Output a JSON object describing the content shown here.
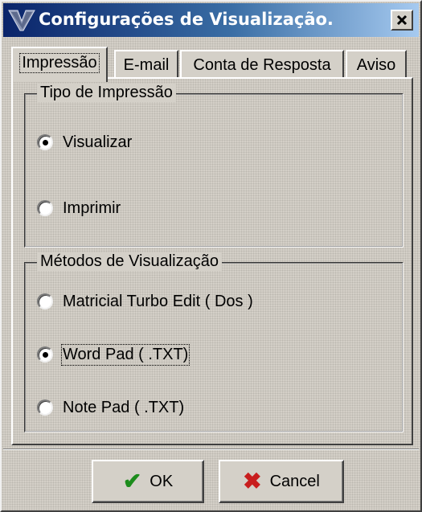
{
  "window": {
    "title": "Configurações de Visualização.",
    "close_glyph": "×",
    "icon": "app-logo-icon"
  },
  "tabs": [
    {
      "label": "Impressão",
      "active": true
    },
    {
      "label": "E-mail",
      "active": false
    },
    {
      "label": "Conta de Resposta",
      "active": false
    },
    {
      "label": "Aviso",
      "active": false
    }
  ],
  "print_type": {
    "legend": "Tipo de Impressão",
    "options": [
      {
        "label": "Visualizar",
        "selected": true
      },
      {
        "label": "Imprimir",
        "selected": false
      }
    ]
  },
  "view_methods": {
    "legend": "Métodos de Visualização",
    "options": [
      {
        "label": "Matricial Turbo Edit ( Dos )",
        "selected": false
      },
      {
        "label": "Word Pad ( .TXT)",
        "selected": true,
        "focused": true
      },
      {
        "label": "Note Pad ( .TXT)",
        "selected": false
      }
    ]
  },
  "buttons": {
    "ok": {
      "label": "OK",
      "icon": "check-icon",
      "color": "#1c8c1c"
    },
    "cancel": {
      "label": "Cancel",
      "icon": "x-icon",
      "color": "#c81e1e"
    }
  }
}
